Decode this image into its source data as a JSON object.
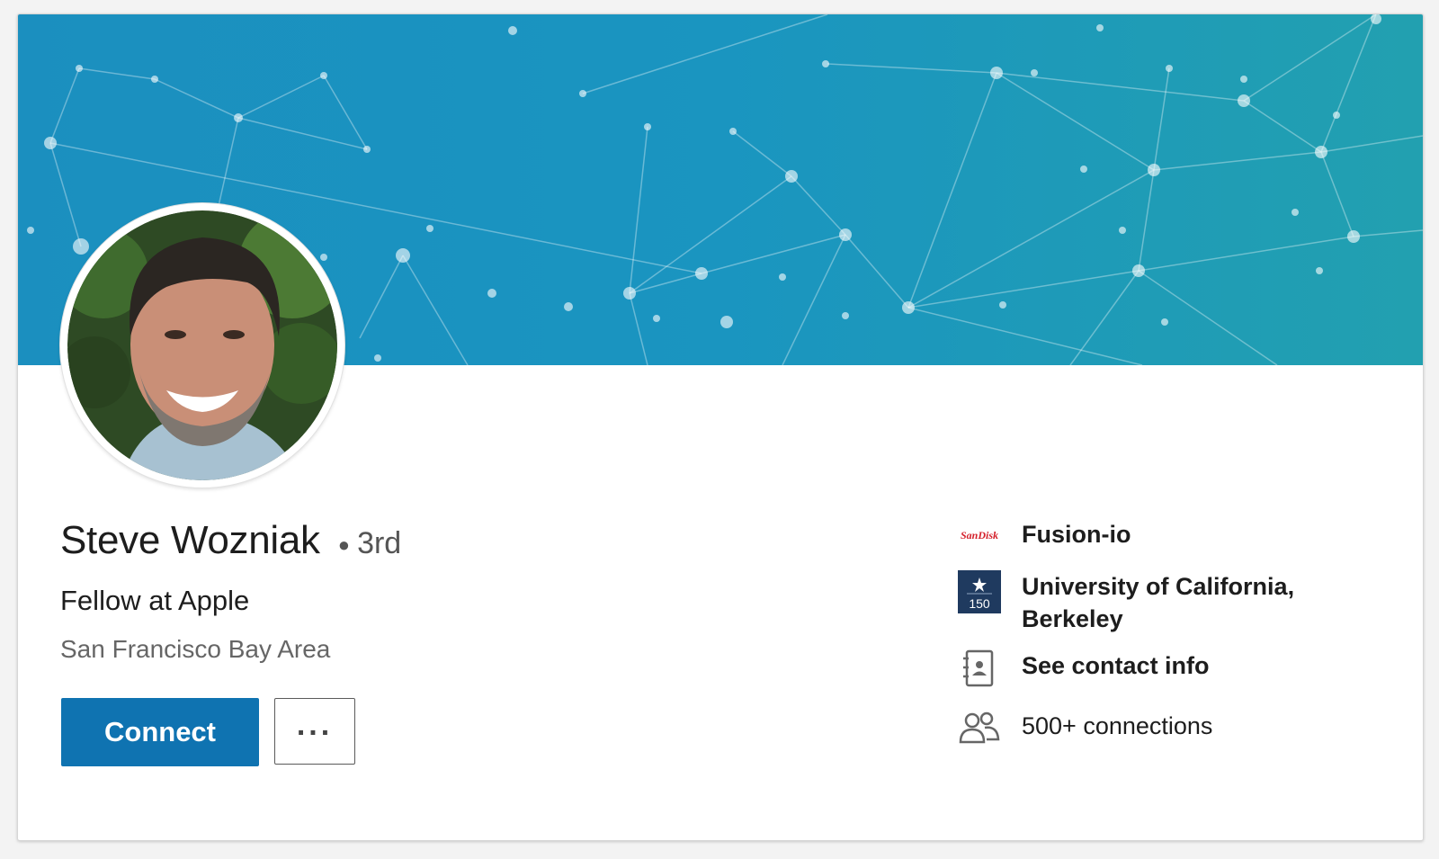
{
  "profile": {
    "name": "Steve Wozniak",
    "degree": "3rd",
    "headline": "Fellow at Apple",
    "location": "San Francisco Bay Area"
  },
  "actions": {
    "connect_label": "Connect",
    "more_label": "..."
  },
  "sidebar": {
    "company": {
      "logo_text": "SanDisk",
      "label": "Fusion-io",
      "icon": "sandisk-logo"
    },
    "school": {
      "label_line1": "University of California,",
      "label_line2": "Berkeley",
      "logo_text": "150",
      "icon": "berkeley-logo"
    },
    "contact": {
      "label": "See contact info",
      "icon": "address-book-icon"
    },
    "connections": {
      "label": "500+ connections",
      "icon": "people-icon"
    }
  },
  "colors": {
    "brand_blue": "#0f73b1",
    "banner_start": "#1b8fbf",
    "banner_end": "#22a0b0",
    "sandisk_red": "#d41f2a"
  }
}
